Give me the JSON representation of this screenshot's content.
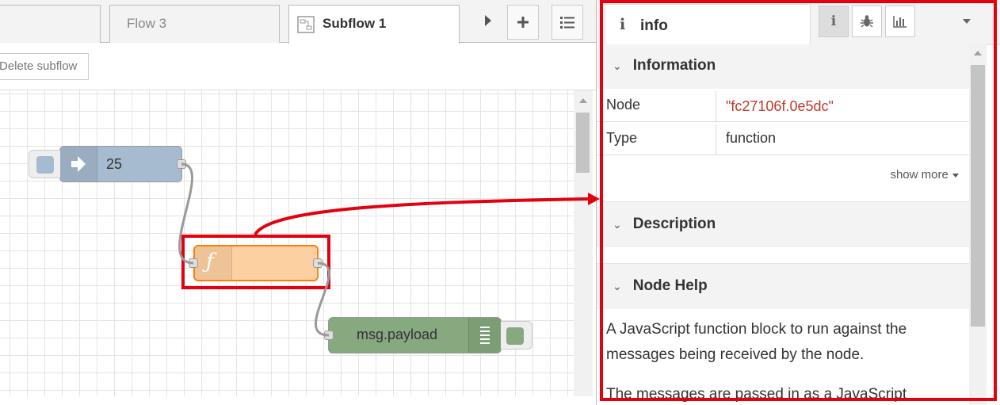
{
  "tabs": {
    "items": [
      {
        "label": ""
      },
      {
        "label": "Flow 3"
      },
      {
        "label": "Subflow 1"
      }
    ]
  },
  "toolbar": {
    "delete_subflow_label": "Delete subflow"
  },
  "nodes": {
    "inject": {
      "label": "25"
    },
    "function": {
      "label": ""
    },
    "debug": {
      "label": "msg.payload"
    }
  },
  "sidebar": {
    "tab_icon": "i",
    "tab_label": "info",
    "buttons": [
      "info-icon",
      "bug-icon",
      "chart-icon",
      "chevron-down-icon"
    ],
    "information": {
      "title": "Information",
      "rows": [
        {
          "key": "Node",
          "value": "\"fc27106f.0e5dc\""
        },
        {
          "key": "Type",
          "value": "function"
        }
      ],
      "show_more": "show more"
    },
    "description": {
      "title": "Description"
    },
    "node_help": {
      "title": "Node Help",
      "text": "A JavaScript function block to run against the messages being received by the node.",
      "text2": "The messages are passed in as a JavaScript"
    }
  },
  "colors": {
    "inject": "#a6bbcf",
    "function": "#fdd0a2",
    "debug": "#87a980",
    "highlight": "#e3000f",
    "node_id": "#c0392b"
  }
}
